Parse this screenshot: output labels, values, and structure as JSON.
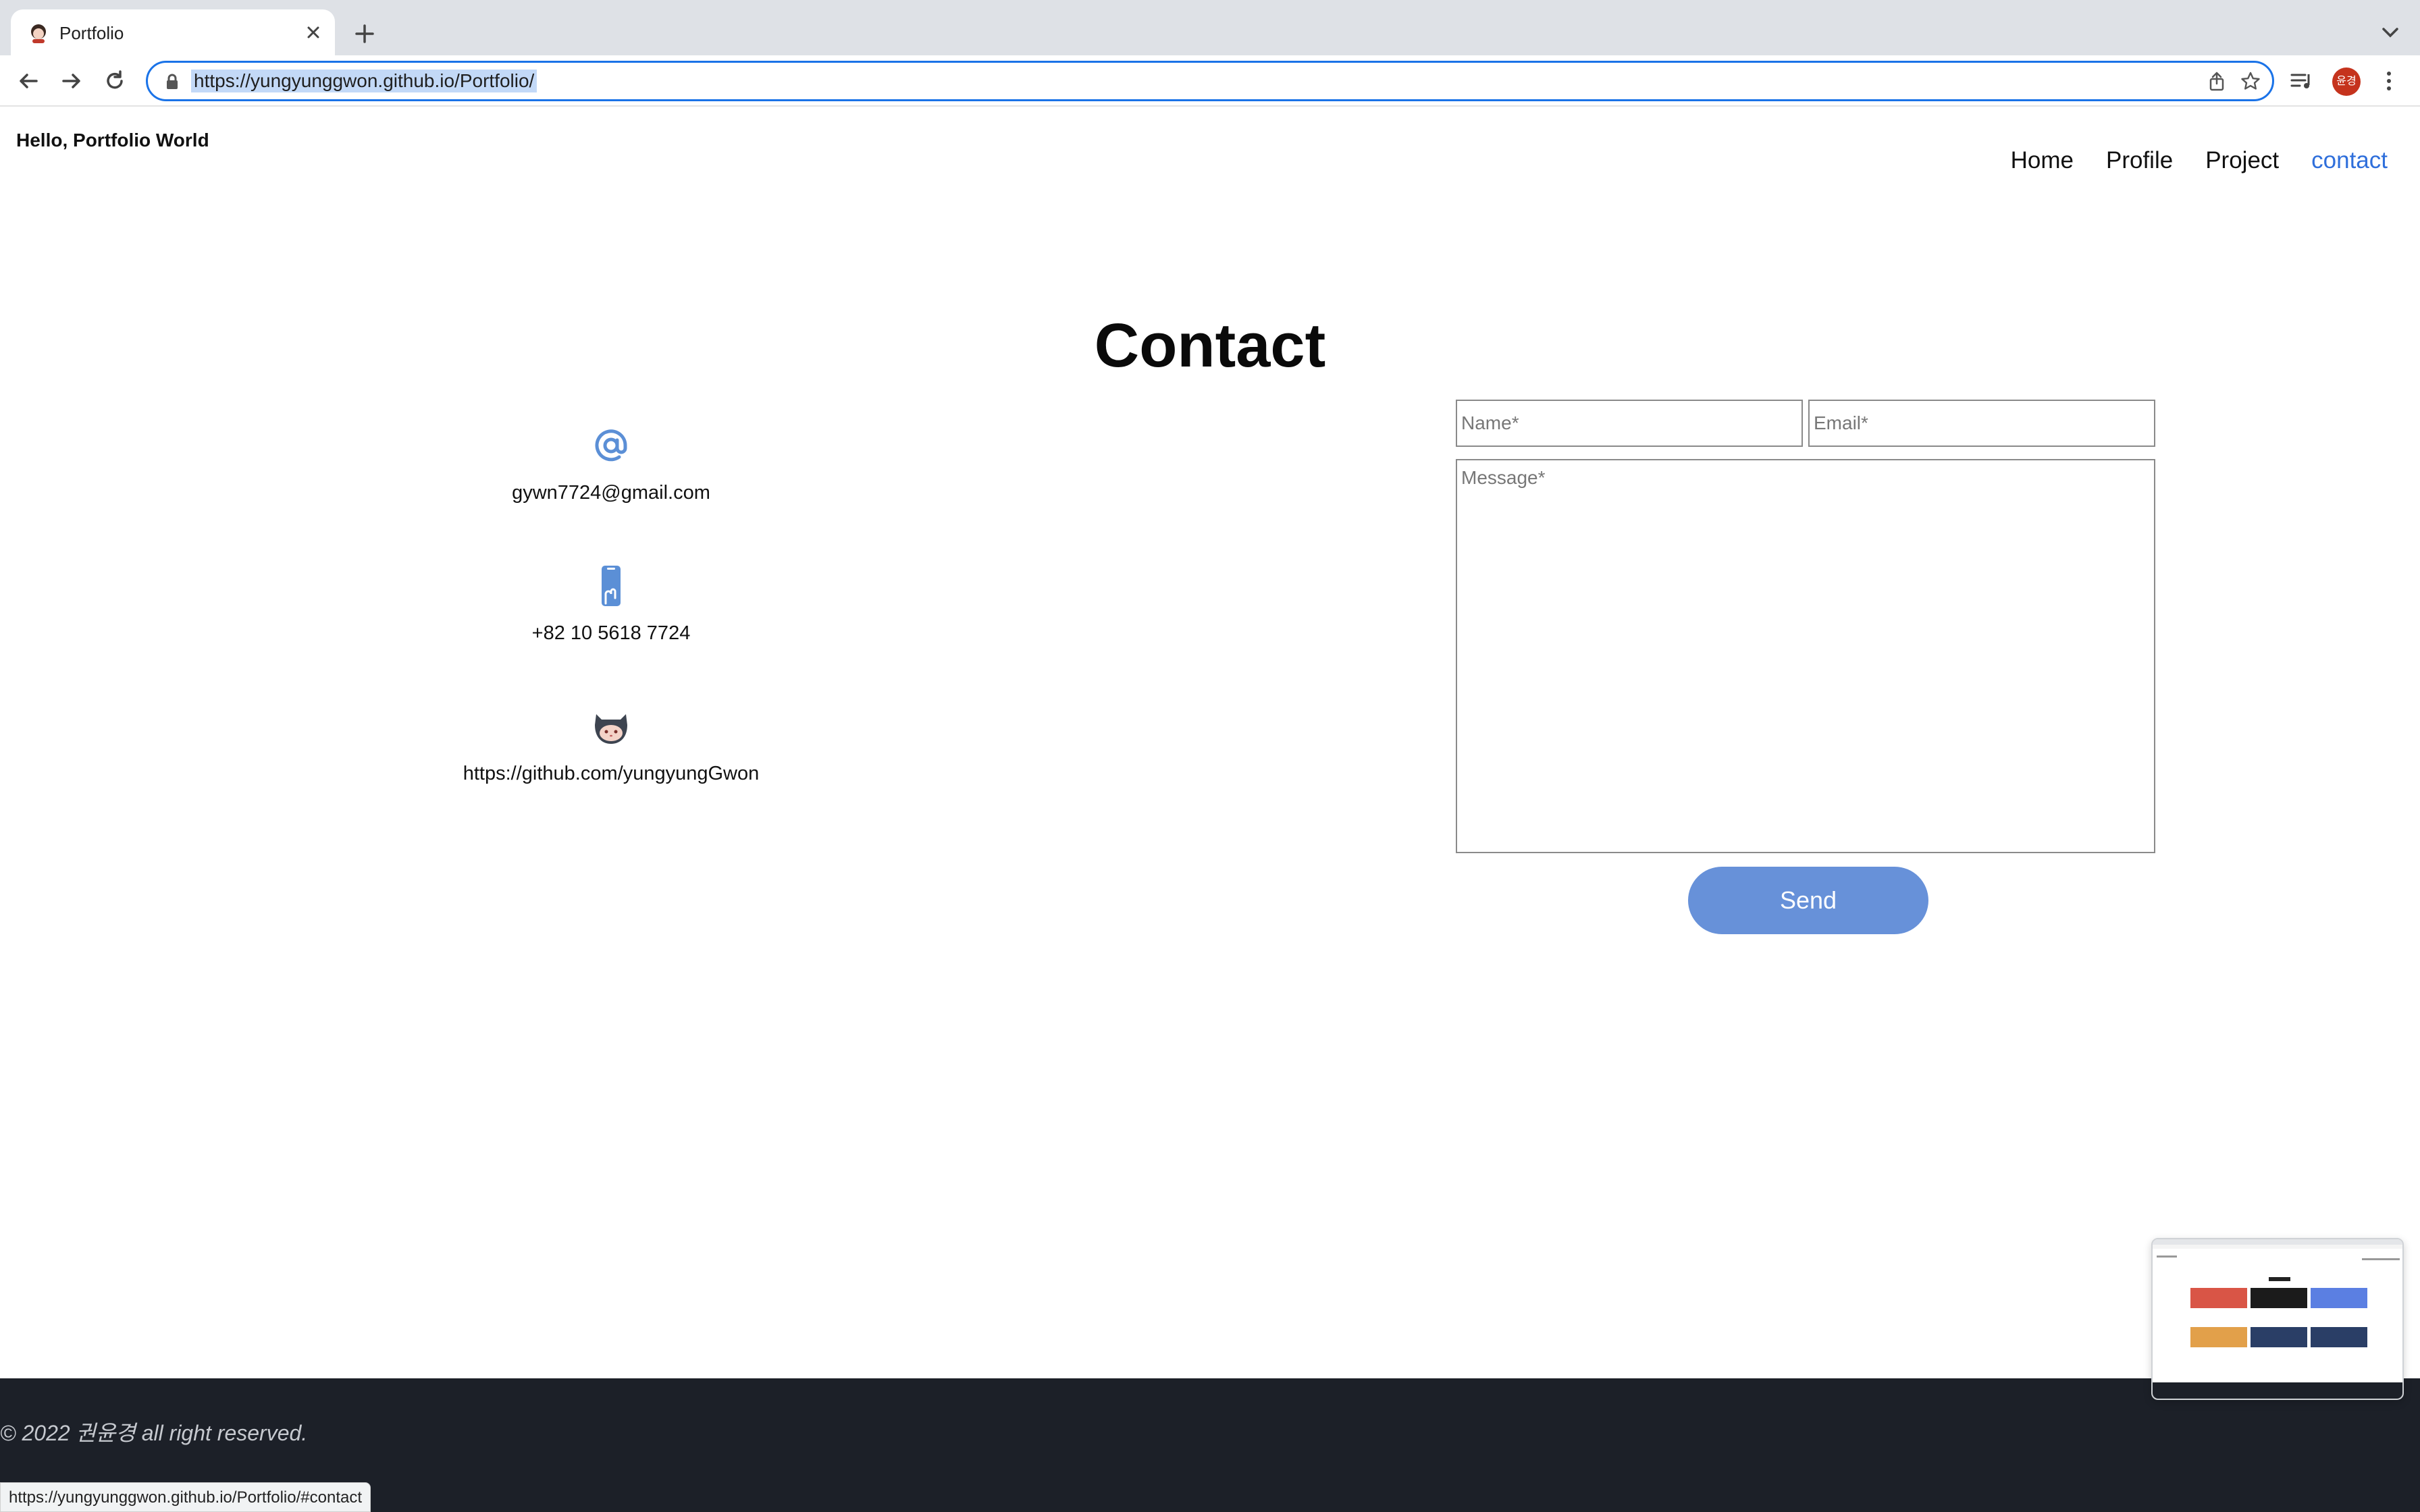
{
  "browser": {
    "tab_title": "Portfolio",
    "url": "https://yungyunggwon.github.io/Portfolio/",
    "profile_initials": "윤경"
  },
  "site": {
    "brand": "Hello, Portfolio World",
    "nav": [
      "Home",
      "Profile",
      "Project",
      "contact"
    ],
    "active_nav": "contact"
  },
  "contact": {
    "title": "Contact",
    "email": "gywn7724@gmail.com",
    "phone": "+82 10 5618 7724",
    "github": "https://github.com/yungyungGwon",
    "form": {
      "name_placeholder": "Name*",
      "email_placeholder": "Email*",
      "message_placeholder": "Message*",
      "send_label": "Send"
    }
  },
  "footer": {
    "copyright": "© 2022 권윤경 all right reserved."
  },
  "status_bar": {
    "hover_url": "https://yungyunggwon.github.io/Portfolio/#contact"
  },
  "colors": {
    "accent": "#2f6fdb",
    "send_button": "#6791d9",
    "footer_bg": "#1c2028",
    "icon_blue": "#5b8fd6"
  },
  "icons": {
    "email": "at-sign-icon",
    "phone": "mobile-phone-icon",
    "github": "github-octocat-icon"
  }
}
